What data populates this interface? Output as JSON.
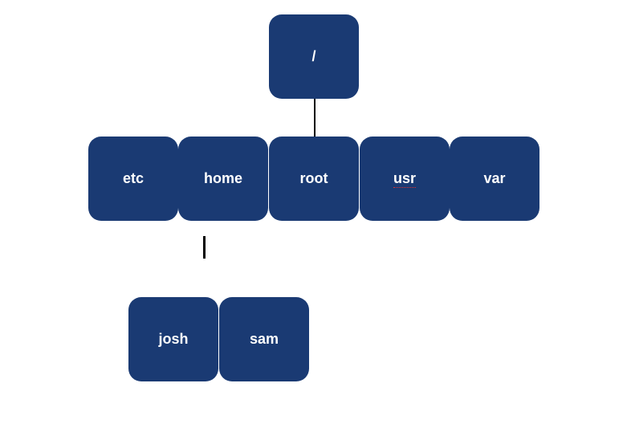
{
  "tree": {
    "root": {
      "label": "/"
    },
    "level1": [
      {
        "id": "etc",
        "label": "etc"
      },
      {
        "id": "home",
        "label": "home"
      },
      {
        "id": "root",
        "label": "root"
      },
      {
        "id": "usr",
        "label": "usr"
      },
      {
        "id": "var",
        "label": "var"
      }
    ],
    "level2_parent": "home",
    "level2": [
      {
        "id": "josh",
        "label": "josh"
      },
      {
        "id": "sam",
        "label": "sam"
      }
    ]
  },
  "style": {
    "node_color": "#1a3a73",
    "text_color": "#ffffff"
  }
}
